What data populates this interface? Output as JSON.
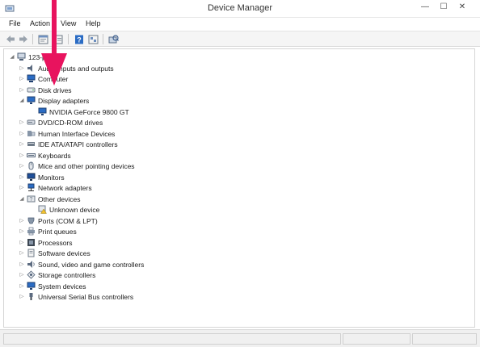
{
  "window": {
    "title": "Device Manager",
    "min_glyph": "—",
    "max_glyph": "☐",
    "close_glyph": "✕"
  },
  "menu": {
    "items": [
      "File",
      "Action",
      "View",
      "Help"
    ]
  },
  "toolbar": {
    "icons": [
      "back-arrow-icon",
      "forward-arrow-icon",
      "properties-icon",
      "show-hide-icon",
      "help-icon",
      "device-view-icon",
      "scan-hardware-icon"
    ]
  },
  "tree": {
    "root": "123-p",
    "nodes": [
      {
        "label": "Audio inputs and outputs",
        "expander": "▷",
        "icon": "speaker-icon"
      },
      {
        "label": "Computer",
        "expander": "▷",
        "icon": "computer-icon"
      },
      {
        "label": "Disk drives",
        "expander": "▷",
        "icon": "disk-drive-icon"
      },
      {
        "label": "Display adapters",
        "expander": "◢",
        "icon": "monitor-icon"
      },
      {
        "label": "NVIDIA GeForce 9800 GT",
        "expander": "",
        "icon": "display-adapter-icon",
        "child": true
      },
      {
        "label": "DVD/CD-ROM drives",
        "expander": "▷",
        "icon": "dvd-drive-icon"
      },
      {
        "label": "Human Interface Devices",
        "expander": "▷",
        "icon": "hid-icon"
      },
      {
        "label": "IDE ATA/ATAPI controllers",
        "expander": "▷",
        "icon": "ide-controller-icon"
      },
      {
        "label": "Keyboards",
        "expander": "▷",
        "icon": "keyboard-icon"
      },
      {
        "label": "Mice and other pointing devices",
        "expander": "▷",
        "icon": "mouse-icon"
      },
      {
        "label": "Monitors",
        "expander": "▷",
        "icon": "monitor-icon"
      },
      {
        "label": "Network adapters",
        "expander": "▷",
        "icon": "network-adapter-icon"
      },
      {
        "label": "Other devices",
        "expander": "◢",
        "icon": "other-devices-icon"
      },
      {
        "label": "Unknown device",
        "expander": "",
        "icon": "unknown-device-warning-icon",
        "child": true
      },
      {
        "label": "Ports (COM & LPT)",
        "expander": "▷",
        "icon": "port-icon"
      },
      {
        "label": "Print queues",
        "expander": "▷",
        "icon": "printer-icon"
      },
      {
        "label": "Processors",
        "expander": "▷",
        "icon": "processor-icon"
      },
      {
        "label": "Software devices",
        "expander": "▷",
        "icon": "software-device-icon"
      },
      {
        "label": "Sound, video and game controllers",
        "expander": "▷",
        "icon": "sound-icon"
      },
      {
        "label": "Storage controllers",
        "expander": "▷",
        "icon": "storage-controller-icon"
      },
      {
        "label": "System devices",
        "expander": "▷",
        "icon": "system-device-icon"
      },
      {
        "label": "Universal Serial Bus controllers",
        "expander": "▷",
        "icon": "usb-icon"
      }
    ]
  },
  "colors": {
    "annotation_arrow": "#e8135e",
    "accent": "#2b6cc4"
  }
}
